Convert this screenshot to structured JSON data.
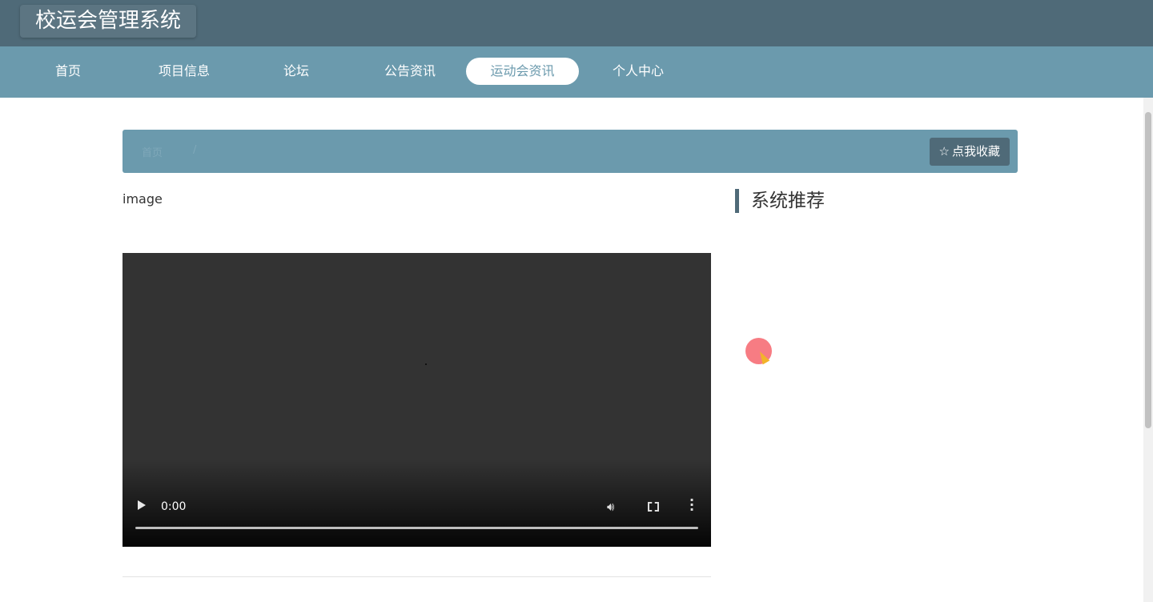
{
  "header": {
    "title": "校运会管理系统"
  },
  "nav": {
    "items": [
      {
        "label": "首页"
      },
      {
        "label": "项目信息"
      },
      {
        "label": "论坛"
      },
      {
        "label": "公告资讯"
      },
      {
        "label": "运动会资讯",
        "active": true
      },
      {
        "label": "个人中心"
      }
    ]
  },
  "breadcrumb": {
    "home": "首页",
    "separator": "/"
  },
  "favorite": {
    "icon": "star-outline-icon",
    "label": "点我收藏"
  },
  "article": {
    "image_alt": "image"
  },
  "video": {
    "time": "0:00",
    "progress": 0
  },
  "sidebar": {
    "title": "系统推荐"
  },
  "colors": {
    "header": "#4f6a78",
    "nav": "#6b9aad",
    "video_bg": "#333333"
  }
}
